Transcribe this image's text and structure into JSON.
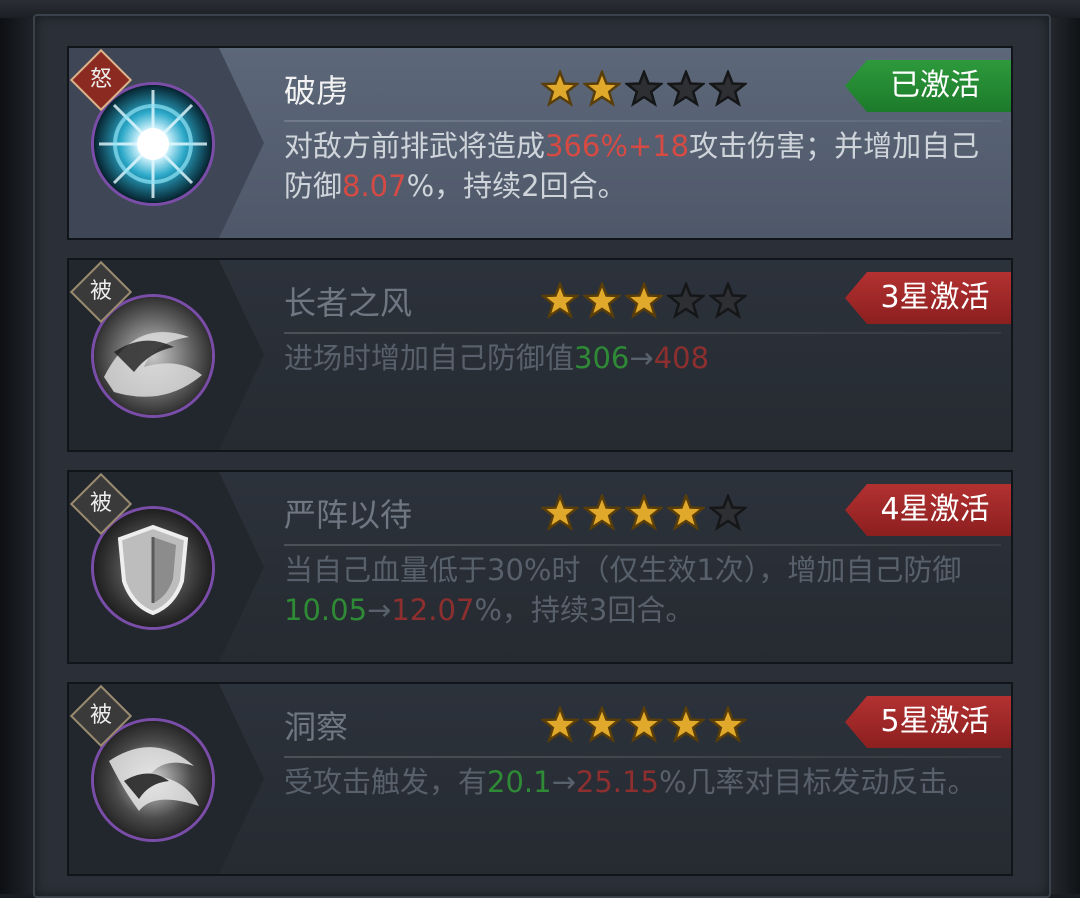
{
  "skills": [
    {
      "name": "破虏",
      "type_badge": "怒",
      "status": "已激活",
      "active": true,
      "stars_filled": 2,
      "stars_total": 5,
      "description": [
        {
          "t": "对敌方前排武将造成",
          "c": "n"
        },
        {
          "t": "366%+18",
          "c": "r"
        },
        {
          "t": "攻击伤害；并增加自己防御",
          "c": "n"
        },
        {
          "t": "8.07",
          "c": "r"
        },
        {
          "t": "%，持续2回合。",
          "c": "n"
        }
      ]
    },
    {
      "name": "长者之风",
      "type_badge": "被",
      "status": "3星激活",
      "active": false,
      "stars_filled": 3,
      "stars_total": 5,
      "description": [
        {
          "t": "进场时增加自己防御值",
          "c": "n"
        },
        {
          "t": "306",
          "c": "g"
        },
        {
          "t": "→",
          "c": "n"
        },
        {
          "t": "408",
          "c": "r"
        }
      ]
    },
    {
      "name": "严阵以待",
      "type_badge": "被",
      "status": "4星激活",
      "active": false,
      "stars_filled": 4,
      "stars_total": 5,
      "description": [
        {
          "t": "当自己血量低于30%时（仅生效1次），增加自己防御",
          "c": "n"
        },
        {
          "t": "10.05",
          "c": "g"
        },
        {
          "t": "→",
          "c": "n"
        },
        {
          "t": "12.07",
          "c": "r"
        },
        {
          "t": "%，持续3回合。",
          "c": "n"
        }
      ]
    },
    {
      "name": "洞察",
      "type_badge": "被",
      "status": "5星激活",
      "active": false,
      "stars_filled": 5,
      "stars_total": 5,
      "description": [
        {
          "t": "受攻击触发，有",
          "c": "n"
        },
        {
          "t": "20.1",
          "c": "g"
        },
        {
          "t": "→",
          "c": "n"
        },
        {
          "t": "25.15",
          "c": "r"
        },
        {
          "t": "%几率对目标发动反击。",
          "c": "n"
        }
      ]
    }
  ],
  "colors": {
    "active_tag": "#1f8a2e",
    "locked_tag": "#a12828",
    "highlight_red": "#d64a44",
    "highlight_green": "#2f8a35",
    "star_gold": "#e0a92b",
    "star_empty": "#2d2f33"
  },
  "icons": [
    "burst-skill-icon",
    "wind-skill-icon",
    "shield-skill-icon",
    "swirl-skill-icon"
  ]
}
